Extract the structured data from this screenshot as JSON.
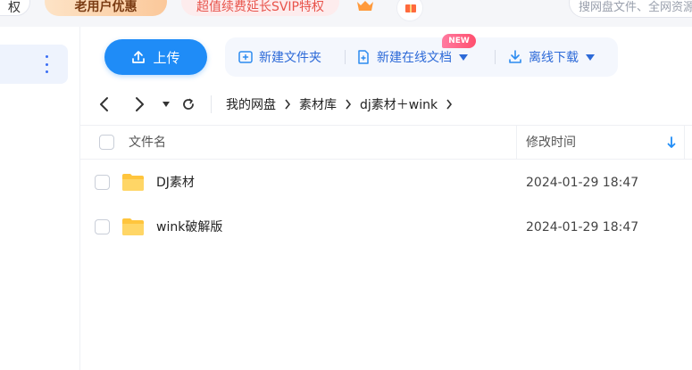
{
  "topbar": {
    "pill_left": "权",
    "pill_offer": "老用户优惠",
    "pill_svip": "超值续费延长SVIP特权",
    "search_placeholder": "搜网盘文件、全网资源"
  },
  "toolbar": {
    "upload_label": "上传",
    "new_folder_label": "新建文件夹",
    "new_online_doc_label": "新建在线文档",
    "new_badge": "NEW",
    "offline_download_label": "离线下载"
  },
  "breadcrumb": {
    "items": [
      "我的网盘",
      "素材库",
      "dj素材＋wink"
    ]
  },
  "table": {
    "columns": {
      "name": "文件名",
      "modified": "修改时间"
    },
    "rows": [
      {
        "name": "DJ素材",
        "modified": "2024-01-29 18:47",
        "type": "folder"
      },
      {
        "name": "wink破解版",
        "modified": "2024-01-29 18:47",
        "type": "folder"
      }
    ]
  },
  "colors": {
    "accent": "#1f8cf7",
    "link_blue": "#2d6ad8",
    "folder_yellow": "#ffc53d",
    "badge_pink": "#ff5a7a"
  }
}
